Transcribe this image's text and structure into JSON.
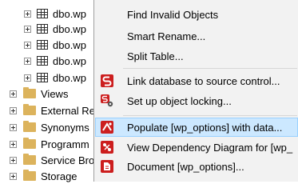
{
  "tree": {
    "tables": [
      "dbo.wp",
      "dbo.wp",
      "dbo.wp",
      "dbo.wp",
      "dbo.wp"
    ],
    "folders": [
      "Views",
      "External Re",
      "Synonyms",
      "Programm",
      "Service Bro",
      "Storage"
    ]
  },
  "menu": {
    "find_invalid": "Find Invalid Objects",
    "smart_rename": "Smart Rename...",
    "split_table": "Split Table...",
    "link_source_control": "Link database to source control...",
    "object_locking": "Set up object locking...",
    "populate": "Populate [wp_options] with data...",
    "dependency_diagram": "View Dependency Diagram for [wp_",
    "document": "Document [wp_options]..."
  },
  "colors": {
    "redgate_red": "#cc1e1e",
    "highlight": "#cce8ff",
    "menu_bg": "#f2f2f2",
    "folder": "#dcb35c"
  }
}
